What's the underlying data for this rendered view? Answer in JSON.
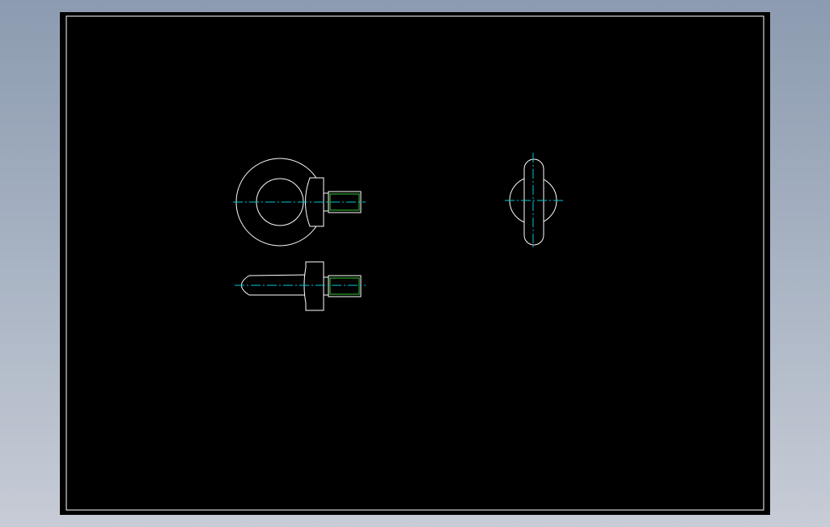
{
  "colors": {
    "background": "#000000",
    "geometry": "#ffffff",
    "centerline": "#00c8d2",
    "thread": "#33cc33",
    "frame": "#ffffff"
  },
  "views": [
    {
      "name": "front-view",
      "description_icon": "eye-bolt-front-view"
    },
    {
      "name": "bottom-view",
      "description_icon": "eye-bolt-bottom-view"
    },
    {
      "name": "side-view",
      "description_icon": "eye-bolt-side-view"
    }
  ]
}
